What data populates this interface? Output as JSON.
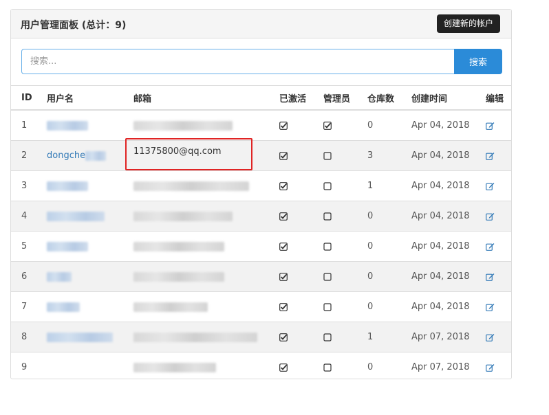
{
  "panel": {
    "title": "用户管理面板 (总计：9)",
    "create_button": "创建新的帐户"
  },
  "search": {
    "placeholder": "搜索...",
    "button": "搜索"
  },
  "table": {
    "headers": [
      "ID",
      "用户名",
      "邮箱",
      "已激活",
      "管理员",
      "仓库数",
      "创建时间",
      "编辑"
    ],
    "rows": [
      {
        "id": "1",
        "username": "",
        "email": "",
        "activated": true,
        "admin": true,
        "repos": "0",
        "created": "Apr 04, 2018"
      },
      {
        "id": "2",
        "username": "dongche",
        "email": "",
        "activated": true,
        "admin": false,
        "repos": "3",
        "created": "Apr 04, 2018"
      },
      {
        "id": "3",
        "username": "",
        "email": "",
        "activated": true,
        "admin": false,
        "repos": "1",
        "created": "Apr 04, 2018"
      },
      {
        "id": "4",
        "username": "",
        "email": "",
        "activated": true,
        "admin": false,
        "repos": "0",
        "created": "Apr 04, 2018"
      },
      {
        "id": "5",
        "username": "",
        "email": "",
        "activated": true,
        "admin": false,
        "repos": "0",
        "created": "Apr 04, 2018"
      },
      {
        "id": "6",
        "username": "",
        "email": "",
        "activated": true,
        "admin": false,
        "repos": "0",
        "created": "Apr 04, 2018"
      },
      {
        "id": "7",
        "username": "",
        "email": "",
        "activated": true,
        "admin": false,
        "repos": "0",
        "created": "Apr 04, 2018"
      },
      {
        "id": "8",
        "username": "",
        "email": "",
        "activated": true,
        "admin": false,
        "repos": "1",
        "created": "Apr 07, 2018"
      },
      {
        "id": "9",
        "username": "",
        "email": "",
        "activated": true,
        "admin": false,
        "repos": "0",
        "created": "Apr 07, 2018"
      }
    ]
  },
  "highlight": {
    "email_text": "1137580‌‌0@qq.com"
  },
  "colors": {
    "link": "#337ab7",
    "search_button": "#2b8bd8",
    "create_button": "#222222",
    "highlight_border": "#e02424",
    "edit_icon": "#337ab7"
  },
  "icons": {
    "activated": "checked-checkbox-icon",
    "not_admin": "unchecked-checkbox-icon",
    "edit": "edit-icon"
  }
}
